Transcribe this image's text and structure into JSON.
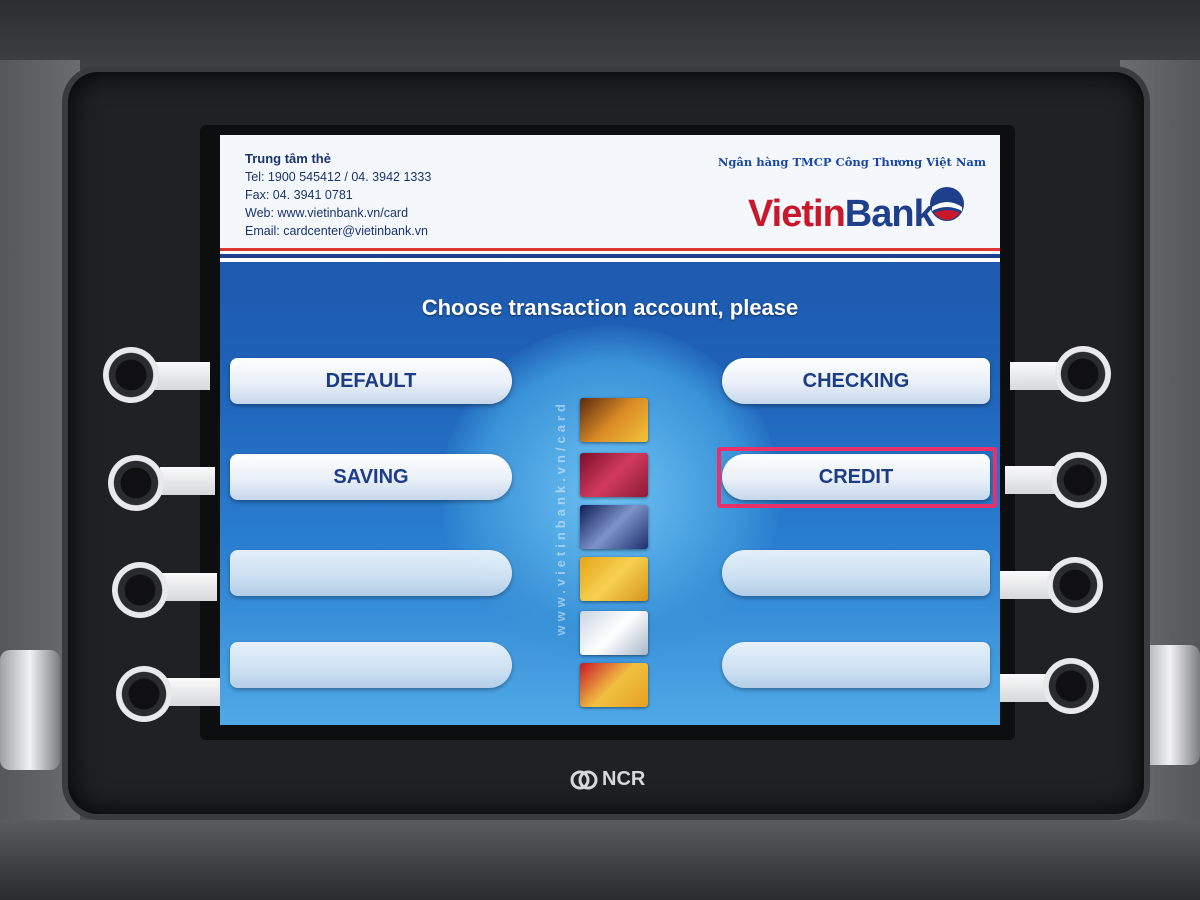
{
  "header": {
    "contact_title": "Trung tâm thẻ",
    "tel": "Tel: 1900 545412 / 04. 3942 1333",
    "fax": "Fax: 04. 3941 0781",
    "web": "Web: www.vietinbank.vn/card",
    "email": "Email: cardcenter@vietinbank.vn",
    "bank_fullname": "Ngân hàng TMCP Công Thương Việt Nam",
    "logo_part1": "Vietin",
    "logo_part2": "Bank"
  },
  "prompt": "Choose transaction account, please",
  "options": {
    "left": [
      "DEFAULT",
      "SAVING",
      "",
      ""
    ],
    "right": [
      "CHECKING",
      "CREDIT",
      "",
      ""
    ]
  },
  "side_text": "www.vietinbank.vn/card",
  "brand": "NCR",
  "colors": {
    "accent_red": "#c8182a",
    "brand_blue": "#1e3f8c",
    "highlight": "#e8316a"
  }
}
